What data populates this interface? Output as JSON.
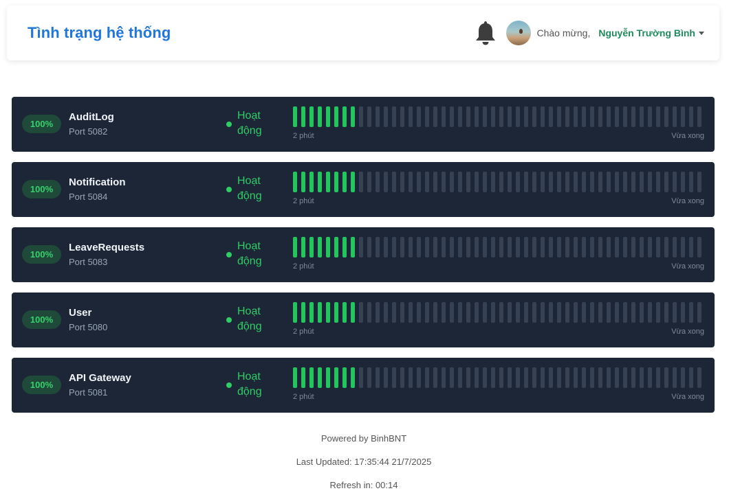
{
  "header": {
    "title": "Tình trạng hệ thống",
    "welcome": "Chào mừng,",
    "user_name": "Nguyễn Trường Bình",
    "bell_icon": "bell-icon"
  },
  "colors": {
    "title": "#2176d9",
    "user_name": "#1f8a5b",
    "row_background": "#1c2636",
    "status_up": "#22c55e",
    "status_empty": "#364154"
  },
  "bar_total": 50,
  "services": [
    {
      "uptime": "100%",
      "name": "AuditLog",
      "port": "Port 5082",
      "status": "Hoạt động",
      "healthy_checks": 8,
      "label_left": "2 phút",
      "label_right": "Vừa xong"
    },
    {
      "uptime": "100%",
      "name": "Notification",
      "port": "Port 5084",
      "status": "Hoạt động",
      "healthy_checks": 8,
      "label_left": "2 phút",
      "label_right": "Vừa xong"
    },
    {
      "uptime": "100%",
      "name": "LeaveRequests",
      "port": "Port 5083",
      "status": "Hoạt động",
      "healthy_checks": 8,
      "label_left": "2 phút",
      "label_right": "Vừa xong"
    },
    {
      "uptime": "100%",
      "name": "User",
      "port": "Port 5080",
      "status": "Hoạt động",
      "healthy_checks": 8,
      "label_left": "2 phút",
      "label_right": "Vừa xong"
    },
    {
      "uptime": "100%",
      "name": "API Gateway",
      "port": "Port 5081",
      "status": "Hoạt động",
      "healthy_checks": 8,
      "label_left": "2 phút",
      "label_right": "Vừa xong"
    }
  ],
  "footer": {
    "powered_by": "Powered by BinhBNT",
    "last_updated": "Last Updated: 17:35:44 21/7/2025",
    "refresh": "Refresh in: 00:14"
  }
}
